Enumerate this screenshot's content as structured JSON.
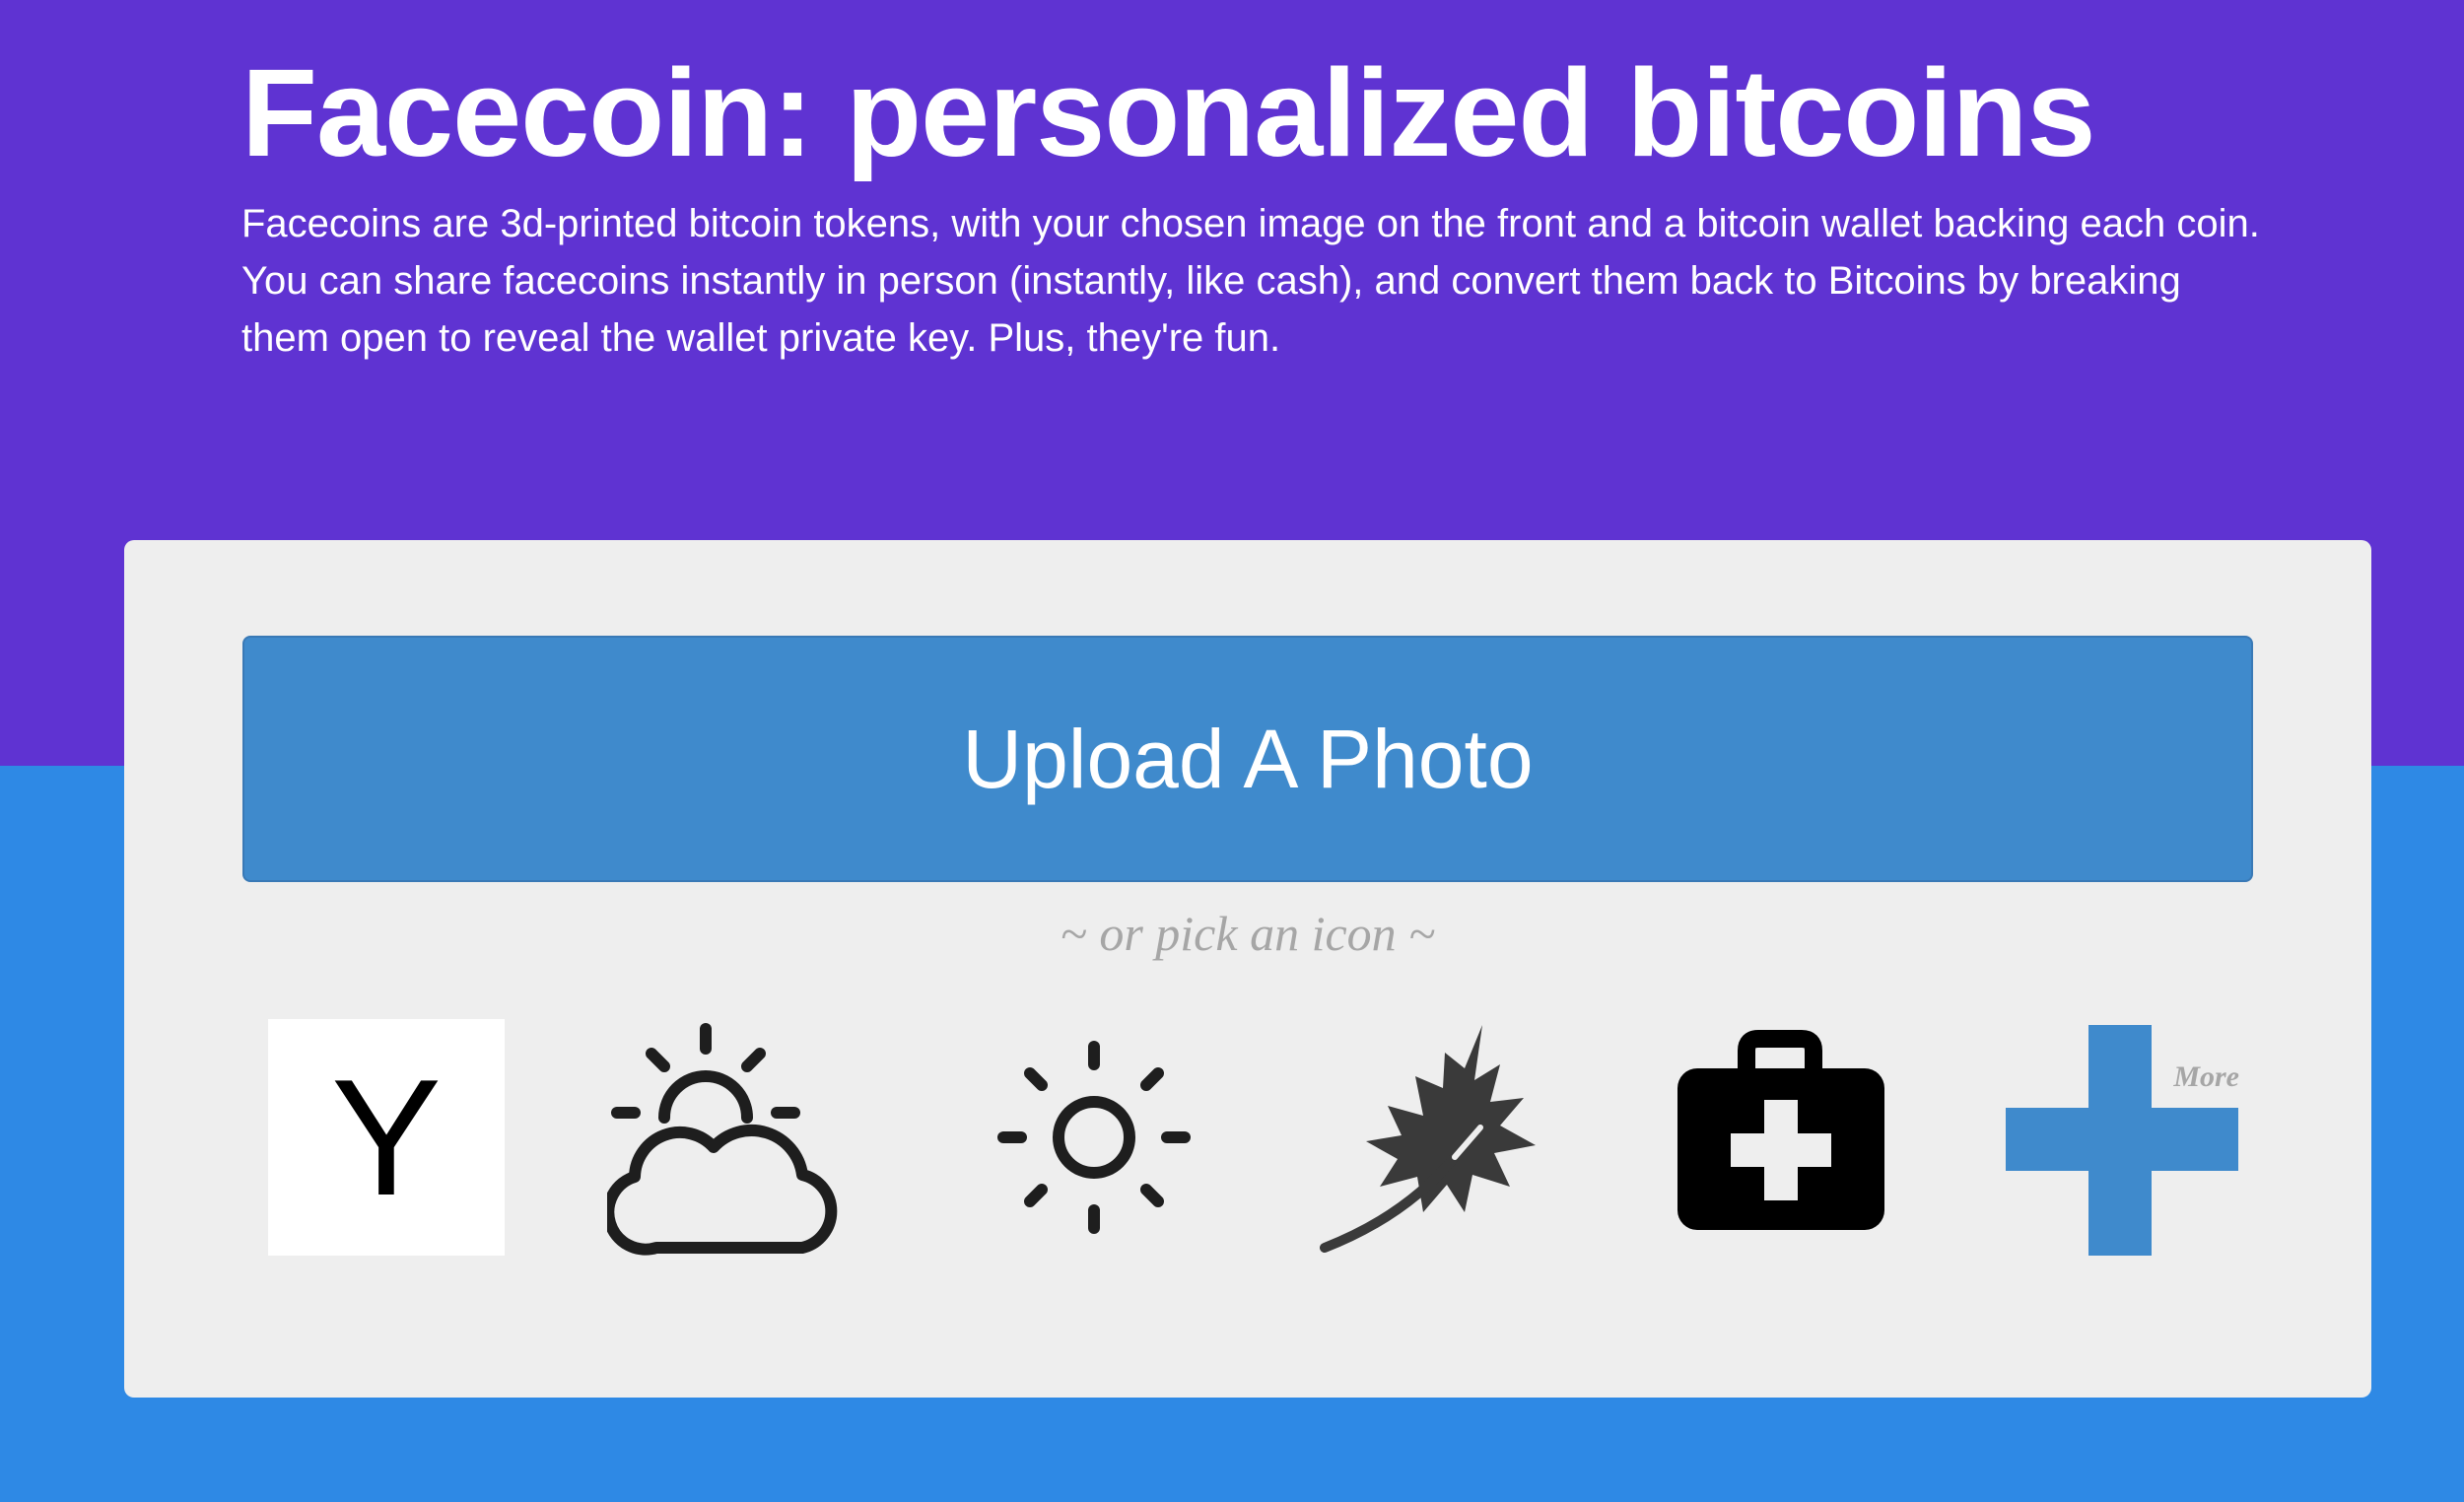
{
  "header": {
    "title": "Facecoin: personalized bitcoins",
    "description": "Facecoins are 3d-printed bitcoin tokens, with your chosen image on the front and a bitcoin wallet backing each coin. You can share facecoins instantly in person (instantly, like cash), and convert them back to Bitcoins by breaking them open to reveal the wallet private key. Plus, they're fun."
  },
  "picker": {
    "upload_label": "Upload A Photo",
    "or_label": "~ or pick an icon ~",
    "icons": [
      {
        "name": "letter-y-icon",
        "text": "Y"
      },
      {
        "name": "partly-cloudy-icon"
      },
      {
        "name": "sun-icon"
      },
      {
        "name": "maple-leaf-icon"
      },
      {
        "name": "first-aid-kit-icon"
      },
      {
        "name": "more-plus-icon",
        "text": "More"
      }
    ]
  },
  "colors": {
    "hero_bg": "#5f33d2",
    "page_bg": "#2e89e5",
    "card_bg": "#eeeeee",
    "upload_button": "#3f8acc",
    "plus_icon": "#3f8acc",
    "muted_text": "#a6a6a6"
  }
}
